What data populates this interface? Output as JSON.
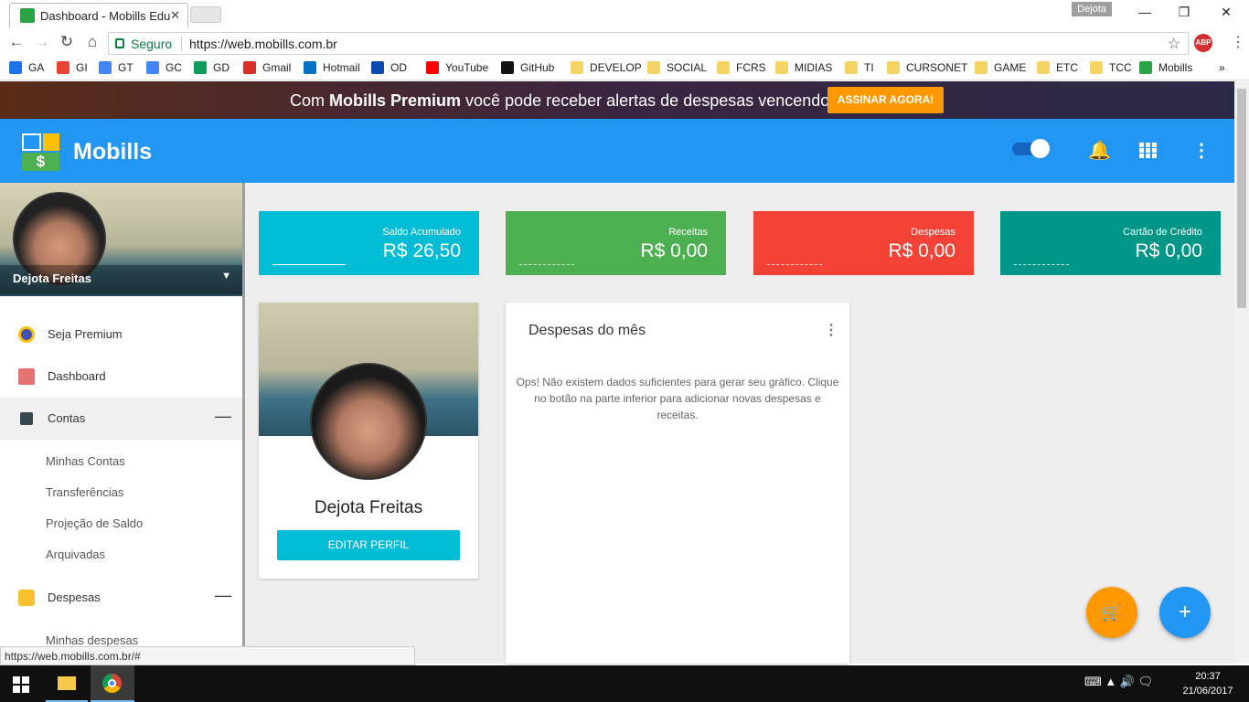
{
  "browser": {
    "tab_title": "Dashboard - Mobills Edu",
    "tab_close": "✕",
    "profile_name": "Dejota",
    "secure_label": "Seguro",
    "url": "https://web.mobills.com.br",
    "status_url": "https://web.mobills.com.br/#",
    "abp_label": "ABP",
    "bookmarks": [
      {
        "label": "GA",
        "color": "#1a73e8"
      },
      {
        "label": "GI",
        "color": "#ea4335"
      },
      {
        "label": "GT",
        "color": "#4285f4"
      },
      {
        "label": "GC",
        "color": "#4285f4"
      },
      {
        "label": "GD",
        "color": "#0f9d58"
      },
      {
        "label": "Gmail",
        "color": "#d93025"
      },
      {
        "label": "Hotmail",
        "color": "#0072c6"
      },
      {
        "label": "OD",
        "color": "#094ab2"
      },
      {
        "label": "YouTube",
        "color": "#ff0000"
      },
      {
        "label": "GitHub",
        "color": "#111111"
      },
      {
        "label": "DEVELOP",
        "color": "#f6d365"
      },
      {
        "label": "SOCIAL",
        "color": "#f6d365"
      },
      {
        "label": "FCRS",
        "color": "#f6d365"
      },
      {
        "label": "MIDIAS",
        "color": "#f6d365"
      },
      {
        "label": "TI",
        "color": "#f6d365"
      },
      {
        "label": "CURSONET",
        "color": "#f6d365"
      },
      {
        "label": "GAME",
        "color": "#f6d365"
      },
      {
        "label": "ETC",
        "color": "#f6d365"
      },
      {
        "label": "TCC",
        "color": "#f6d365"
      },
      {
        "label": "Mobills",
        "color": "#2aa344"
      }
    ],
    "more_bookmarks": "»"
  },
  "promo": {
    "text_prefix": "Com ",
    "text_bold": "Mobills Premium",
    "text_suffix": " você pode receber alertas de despesas vencendo!",
    "button": "ASSINAR AGORA!"
  },
  "appbar": {
    "brand": "Mobills",
    "logo_symbol": "$"
  },
  "sidebar": {
    "user_name": "Dejota Freitas",
    "menu": [
      {
        "label": "Seja Premium",
        "icon": "crown-icon"
      },
      {
        "label": "Dashboard",
        "icon": "home-icon"
      },
      {
        "label": "Contas",
        "icon": "wallet-icon"
      },
      {
        "label": "Despesas",
        "icon": "coins-icon"
      }
    ],
    "contas_sub": [
      "Minhas Contas",
      "Transferências",
      "Projeção de Saldo",
      "Arquivadas"
    ],
    "despesas_sub": [
      "Minhas despesas"
    ],
    "collapse_symbol": "—"
  },
  "stats": [
    {
      "title": "Saldo Acumulado",
      "value": "R$ 26,50",
      "color": "#00bcd4"
    },
    {
      "title": "Receitas",
      "value": "R$ 0,00",
      "color": "#4caf50"
    },
    {
      "title": "Despesas",
      "value": "R$ 0,00",
      "color": "#f44336"
    },
    {
      "title": "Cartão de Crédito",
      "value": "R$ 0,00",
      "color": "#009688"
    }
  ],
  "profile": {
    "name": "Dejota Freitas",
    "edit_button": "EDITAR PERFIL"
  },
  "expenses_card": {
    "title": "Despesas do mês",
    "message": "Ops! Não existem dados suficientes para gerar seu gráfico. Clique no botão na parte inferior para adicionar novas despesas e receitas."
  },
  "fabs": {
    "cart": "🛒",
    "add": "+"
  },
  "taskbar": {
    "time": "20:37",
    "date": "21/06/2017",
    "tray": "⌨ ▲ 🔊 🗨"
  }
}
